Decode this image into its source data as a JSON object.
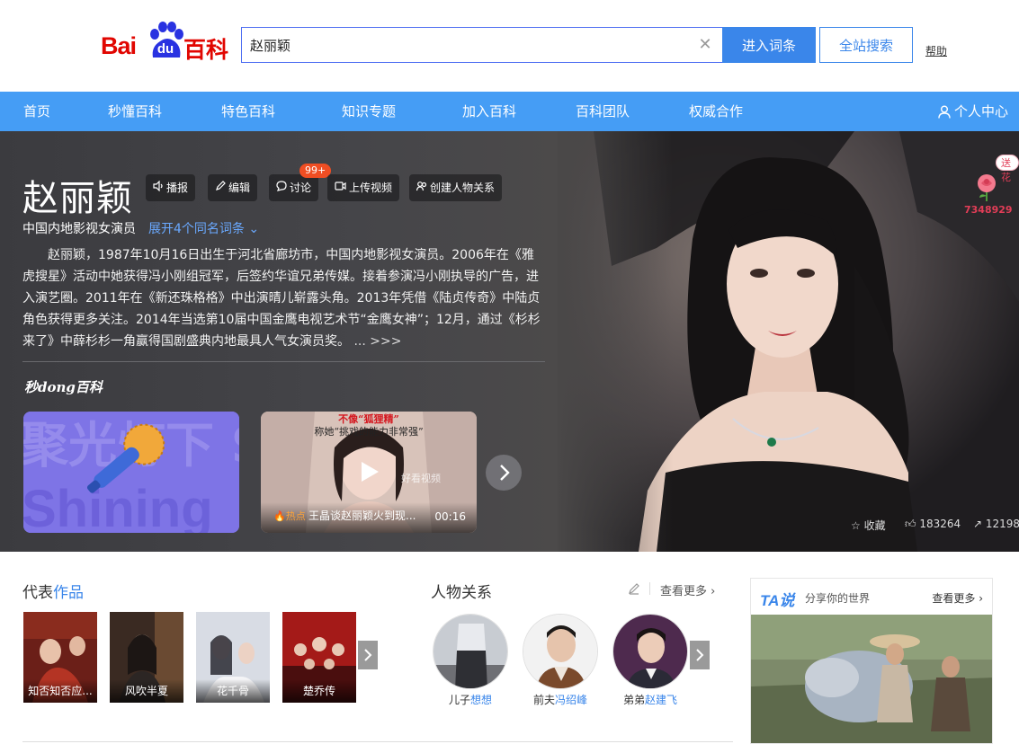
{
  "brand": {
    "logo_bai": "Bai",
    "logo_du": "du",
    "logo_baike": "百科"
  },
  "search": {
    "value": "赵丽颖",
    "clear_icon": "close-icon",
    "enter_label": "进入词条",
    "all_label": "全站搜索",
    "help_label": "帮助"
  },
  "nav": {
    "items": [
      "首页",
      "秒懂百科",
      "特色百科",
      "知识专题",
      "加入百科",
      "百科团队",
      "权威合作"
    ],
    "user_label": "个人中心"
  },
  "hero": {
    "title": "赵丽颖",
    "actions": [
      {
        "label": "播报",
        "icon": "speaker-icon"
      },
      {
        "label": "编辑",
        "icon": "pencil-icon"
      },
      {
        "label": "讨论",
        "icon": "comment-icon"
      },
      {
        "label": "上传视频",
        "icon": "video-icon"
      },
      {
        "label": "创建人物关系",
        "icon": "relation-icon"
      }
    ],
    "discuss_badge": "99+",
    "subtitle": "中国内地影视女演员",
    "more_terms": "展开4个同名词条",
    "description": "赵丽颖，1987年10月16日出生于河北省廊坊市，中国内地影视女演员。2006年在《雅虎搜星》活动中她获得冯小刚组冠军，后签约华谊兄弟传媒。接着参演冯小刚执导的广告，进入演艺圈。2011年在《新还珠格格》中出演晴儿崭露头角。2013年凭借《陆贞传奇》中陆贞角色获得更多关注。2014年当选第10届中国金鹰电视艺术节“金鹰女神”；12月，通过《杉杉来了》中薛杉杉一角赢得国剧盛典内地最具人气女演员奖。",
    "desc_more": "... >>>",
    "miaodong_logo": "秒dong百科",
    "card1_text": "聚光灯下 Shining",
    "card2": {
      "caption1": "不像“狐狸精”",
      "caption2": "称她“挑戏的能力非常强”",
      "watermark": "好看视频",
      "tag": "热点",
      "title": "王晶谈赵丽颖火到现...",
      "duration": "00:16"
    },
    "flower": {
      "tag": "送花",
      "count": "7348929"
    },
    "stats": {
      "collect": "收藏",
      "likes": "183264",
      "shares": "12198"
    }
  },
  "works": {
    "title_a": "代表",
    "title_b": "作品",
    "items": [
      "知否知否应...",
      "风吹半夏",
      "花千骨",
      "楚乔传"
    ]
  },
  "relations": {
    "title": "人物关系",
    "more": "查看更多",
    "people": [
      {
        "role": "儿子",
        "name": "想想"
      },
      {
        "role": "前夫",
        "name": "冯绍峰"
      },
      {
        "role": "弟弟",
        "name": "赵建飞"
      }
    ]
  },
  "ta": {
    "logo": "TA说",
    "slogan": "分享你的世界",
    "more": "查看更多"
  },
  "colors": {
    "brand_red": "#e10601",
    "primary_blue": "#3a86ea",
    "nav_blue": "#459df5",
    "badge_orange": "#f04e23"
  }
}
